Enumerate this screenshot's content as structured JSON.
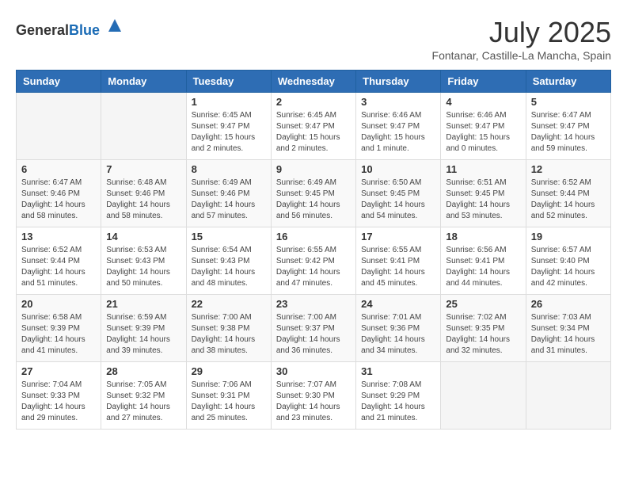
{
  "header": {
    "logo_general": "General",
    "logo_blue": "Blue",
    "month_year": "July 2025",
    "location": "Fontanar, Castille-La Mancha, Spain"
  },
  "weekdays": [
    "Sunday",
    "Monday",
    "Tuesday",
    "Wednesday",
    "Thursday",
    "Friday",
    "Saturday"
  ],
  "weeks": [
    [
      {
        "day": "",
        "sunrise": "",
        "sunset": "",
        "daylight": "",
        "empty": true
      },
      {
        "day": "",
        "sunrise": "",
        "sunset": "",
        "daylight": "",
        "empty": true
      },
      {
        "day": "1",
        "sunrise": "Sunrise: 6:45 AM",
        "sunset": "Sunset: 9:47 PM",
        "daylight": "Daylight: 15 hours and 2 minutes."
      },
      {
        "day": "2",
        "sunrise": "Sunrise: 6:45 AM",
        "sunset": "Sunset: 9:47 PM",
        "daylight": "Daylight: 15 hours and 2 minutes."
      },
      {
        "day": "3",
        "sunrise": "Sunrise: 6:46 AM",
        "sunset": "Sunset: 9:47 PM",
        "daylight": "Daylight: 15 hours and 1 minute."
      },
      {
        "day": "4",
        "sunrise": "Sunrise: 6:46 AM",
        "sunset": "Sunset: 9:47 PM",
        "daylight": "Daylight: 15 hours and 0 minutes."
      },
      {
        "day": "5",
        "sunrise": "Sunrise: 6:47 AM",
        "sunset": "Sunset: 9:47 PM",
        "daylight": "Daylight: 14 hours and 59 minutes."
      }
    ],
    [
      {
        "day": "6",
        "sunrise": "Sunrise: 6:47 AM",
        "sunset": "Sunset: 9:46 PM",
        "daylight": "Daylight: 14 hours and 58 minutes."
      },
      {
        "day": "7",
        "sunrise": "Sunrise: 6:48 AM",
        "sunset": "Sunset: 9:46 PM",
        "daylight": "Daylight: 14 hours and 58 minutes."
      },
      {
        "day": "8",
        "sunrise": "Sunrise: 6:49 AM",
        "sunset": "Sunset: 9:46 PM",
        "daylight": "Daylight: 14 hours and 57 minutes."
      },
      {
        "day": "9",
        "sunrise": "Sunrise: 6:49 AM",
        "sunset": "Sunset: 9:45 PM",
        "daylight": "Daylight: 14 hours and 56 minutes."
      },
      {
        "day": "10",
        "sunrise": "Sunrise: 6:50 AM",
        "sunset": "Sunset: 9:45 PM",
        "daylight": "Daylight: 14 hours and 54 minutes."
      },
      {
        "day": "11",
        "sunrise": "Sunrise: 6:51 AM",
        "sunset": "Sunset: 9:45 PM",
        "daylight": "Daylight: 14 hours and 53 minutes."
      },
      {
        "day": "12",
        "sunrise": "Sunrise: 6:52 AM",
        "sunset": "Sunset: 9:44 PM",
        "daylight": "Daylight: 14 hours and 52 minutes."
      }
    ],
    [
      {
        "day": "13",
        "sunrise": "Sunrise: 6:52 AM",
        "sunset": "Sunset: 9:44 PM",
        "daylight": "Daylight: 14 hours and 51 minutes."
      },
      {
        "day": "14",
        "sunrise": "Sunrise: 6:53 AM",
        "sunset": "Sunset: 9:43 PM",
        "daylight": "Daylight: 14 hours and 50 minutes."
      },
      {
        "day": "15",
        "sunrise": "Sunrise: 6:54 AM",
        "sunset": "Sunset: 9:43 PM",
        "daylight": "Daylight: 14 hours and 48 minutes."
      },
      {
        "day": "16",
        "sunrise": "Sunrise: 6:55 AM",
        "sunset": "Sunset: 9:42 PM",
        "daylight": "Daylight: 14 hours and 47 minutes."
      },
      {
        "day": "17",
        "sunrise": "Sunrise: 6:55 AM",
        "sunset": "Sunset: 9:41 PM",
        "daylight": "Daylight: 14 hours and 45 minutes."
      },
      {
        "day": "18",
        "sunrise": "Sunrise: 6:56 AM",
        "sunset": "Sunset: 9:41 PM",
        "daylight": "Daylight: 14 hours and 44 minutes."
      },
      {
        "day": "19",
        "sunrise": "Sunrise: 6:57 AM",
        "sunset": "Sunset: 9:40 PM",
        "daylight": "Daylight: 14 hours and 42 minutes."
      }
    ],
    [
      {
        "day": "20",
        "sunrise": "Sunrise: 6:58 AM",
        "sunset": "Sunset: 9:39 PM",
        "daylight": "Daylight: 14 hours and 41 minutes."
      },
      {
        "day": "21",
        "sunrise": "Sunrise: 6:59 AM",
        "sunset": "Sunset: 9:39 PM",
        "daylight": "Daylight: 14 hours and 39 minutes."
      },
      {
        "day": "22",
        "sunrise": "Sunrise: 7:00 AM",
        "sunset": "Sunset: 9:38 PM",
        "daylight": "Daylight: 14 hours and 38 minutes."
      },
      {
        "day": "23",
        "sunrise": "Sunrise: 7:00 AM",
        "sunset": "Sunset: 9:37 PM",
        "daylight": "Daylight: 14 hours and 36 minutes."
      },
      {
        "day": "24",
        "sunrise": "Sunrise: 7:01 AM",
        "sunset": "Sunset: 9:36 PM",
        "daylight": "Daylight: 14 hours and 34 minutes."
      },
      {
        "day": "25",
        "sunrise": "Sunrise: 7:02 AM",
        "sunset": "Sunset: 9:35 PM",
        "daylight": "Daylight: 14 hours and 32 minutes."
      },
      {
        "day": "26",
        "sunrise": "Sunrise: 7:03 AM",
        "sunset": "Sunset: 9:34 PM",
        "daylight": "Daylight: 14 hours and 31 minutes."
      }
    ],
    [
      {
        "day": "27",
        "sunrise": "Sunrise: 7:04 AM",
        "sunset": "Sunset: 9:33 PM",
        "daylight": "Daylight: 14 hours and 29 minutes."
      },
      {
        "day": "28",
        "sunrise": "Sunrise: 7:05 AM",
        "sunset": "Sunset: 9:32 PM",
        "daylight": "Daylight: 14 hours and 27 minutes."
      },
      {
        "day": "29",
        "sunrise": "Sunrise: 7:06 AM",
        "sunset": "Sunset: 9:31 PM",
        "daylight": "Daylight: 14 hours and 25 minutes."
      },
      {
        "day": "30",
        "sunrise": "Sunrise: 7:07 AM",
        "sunset": "Sunset: 9:30 PM",
        "daylight": "Daylight: 14 hours and 23 minutes."
      },
      {
        "day": "31",
        "sunrise": "Sunrise: 7:08 AM",
        "sunset": "Sunset: 9:29 PM",
        "daylight": "Daylight: 14 hours and 21 minutes."
      },
      {
        "day": "",
        "sunrise": "",
        "sunset": "",
        "daylight": "",
        "empty": true
      },
      {
        "day": "",
        "sunrise": "",
        "sunset": "",
        "daylight": "",
        "empty": true
      }
    ]
  ]
}
